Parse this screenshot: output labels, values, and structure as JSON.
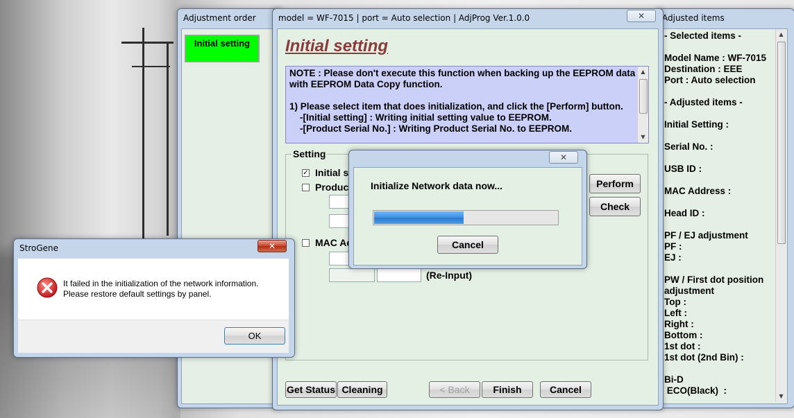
{
  "adjustment_order": {
    "title": "Adjustment order",
    "items": [
      "Initial setting"
    ]
  },
  "main_window": {
    "title": "model = WF-7015 | port = Auto selection | AdjProg Ver.1.0.0",
    "close_label": "✕",
    "heading": "Initial setting",
    "note_lines": [
      "NOTE : Please don't execute this function when backing up the EEPROM data",
      "with EEPROM Data Copy function.",
      "",
      "1) Please select item that does initialization, and click the [Perform] button.",
      "    -[Initial setting] : Writing initial setting value to EEPROM.",
      "    -[Product Serial No.] : Writing Product Serial No. to EEPROM."
    ],
    "setting_group": "Setting",
    "options": [
      {
        "label": "Initial se",
        "checked": true
      },
      {
        "label": "Product",
        "checked": false
      },
      {
        "label": "MAC Ad",
        "checked": false
      }
    ],
    "reinput_label": "(Re-Input)",
    "perform_label": "Perform",
    "check_label": "Check",
    "buttons": {
      "get_status": "Get Status",
      "cleaning": "Cleaning",
      "back": "< Back",
      "finish": "Finish",
      "cancel": "Cancel"
    }
  },
  "progress_dialog": {
    "close_label": "✕",
    "message": "Initialize Network data now...",
    "progress_fraction": 0.49,
    "cancel_label": "Cancel",
    "bar_color": "#3f8fe0"
  },
  "error_dialog": {
    "title": "StroGene",
    "close_label": "✕",
    "icon": "error-icon",
    "message_line1": "It failed in the initialization of the network information.",
    "message_line2": "Please restore default settings by panel.",
    "ok_label": "OK"
  },
  "adjusted_items": {
    "title": "Adjusted items",
    "lines": [
      "- Selected items -",
      "",
      "Model Name : WF-7015",
      "Destination : EEE",
      "Port : Auto selection",
      "",
      "- Adjusted items -",
      "",
      "Initial Setting :",
      "",
      "Serial No. :",
      "",
      "USB ID :",
      "",
      "MAC Address :",
      "",
      "Head ID :",
      "",
      "PF / EJ adjustment",
      "PF :",
      "EJ :",
      "",
      "PW / First dot position",
      "adjustment",
      "Top :",
      "Left :",
      "Right :",
      "Bottom :",
      "1st dot :",
      "1st dot (2nd Bin) :",
      "",
      "Bi-D",
      " ECO(Black)  :"
    ]
  }
}
